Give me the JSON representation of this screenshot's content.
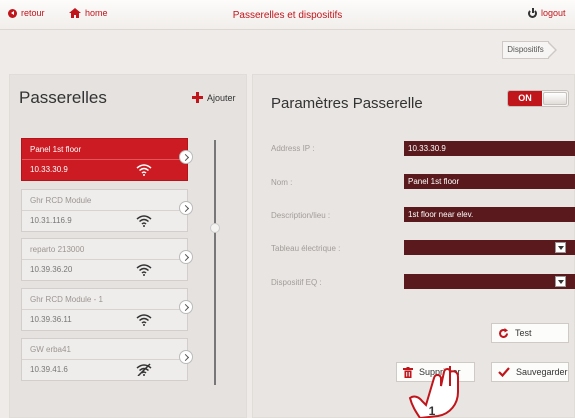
{
  "header": {
    "back_label": "retour",
    "home_label": "home",
    "title": "Passerelles et dispositifs",
    "logout_label": "logout"
  },
  "breadcrumb": {
    "label": "Dispositifs"
  },
  "left": {
    "title": "Passerelles",
    "add_label": "Ajouter",
    "gateways": [
      {
        "name": "Panel 1st floor",
        "ip": "10.33.30.9",
        "status": "connected",
        "selected": true
      },
      {
        "name": "Ghr RCD Module",
        "ip": "10.31.116.9",
        "status": "connected",
        "selected": false
      },
      {
        "name": "reparto 213000",
        "ip": "10.39.36.20",
        "status": "connected",
        "selected": false
      },
      {
        "name": "Ghr RCD Module - 1",
        "ip": "10.39.36.11",
        "status": "connected",
        "selected": false
      },
      {
        "name": "GW erba41",
        "ip": "10.39.41.6",
        "status": "disconnected",
        "selected": false
      }
    ]
  },
  "right": {
    "title": "Paramètres Passerelle",
    "toggle_label": "ON",
    "fields": [
      {
        "label": "Address IP :",
        "value": "10.33.30.9"
      },
      {
        "label": "Nom :",
        "value": "Panel 1st floor"
      },
      {
        "label": "Description/lieu :",
        "value": "1st floor near elev."
      }
    ],
    "selects": [
      {
        "label": "Tableau électrique :",
        "value": ""
      },
      {
        "label": "Dispositif EQ :",
        "value": ""
      }
    ],
    "test_label": "Test",
    "delete_label": "Supprimer",
    "save_label": "Sauvegarder"
  },
  "annotation": {
    "label": "1"
  },
  "colors": {
    "accent": "#c0151b",
    "field_bg": "#5a1a1d",
    "panel_bg": "#e9e5e2"
  }
}
